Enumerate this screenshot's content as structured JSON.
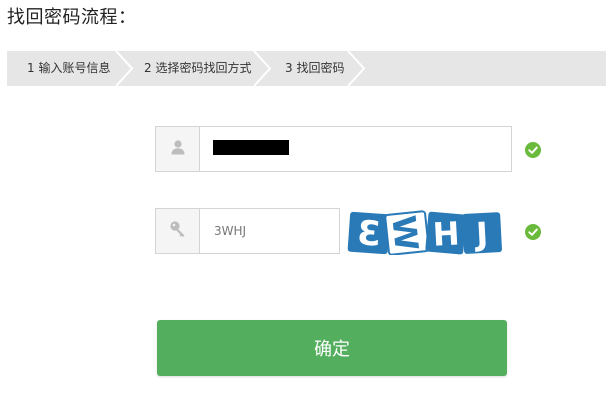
{
  "page": {
    "title": "找回密码流程："
  },
  "steps": [
    {
      "label": "1 输入账号信息"
    },
    {
      "label": "2 选择密码找回方式"
    },
    {
      "label": "3 找回密码"
    }
  ],
  "account_field": {
    "icon": "user-icon",
    "value": ""
  },
  "captcha_field": {
    "icon": "key-icon",
    "value": "3WHJ"
  },
  "captcha_image": {
    "text": "3WHJ",
    "color": "#2a7ab8"
  },
  "status": {
    "ok_color": "#6aba3b"
  },
  "confirm_button": {
    "label": "确定",
    "color": "#53ae5e"
  }
}
